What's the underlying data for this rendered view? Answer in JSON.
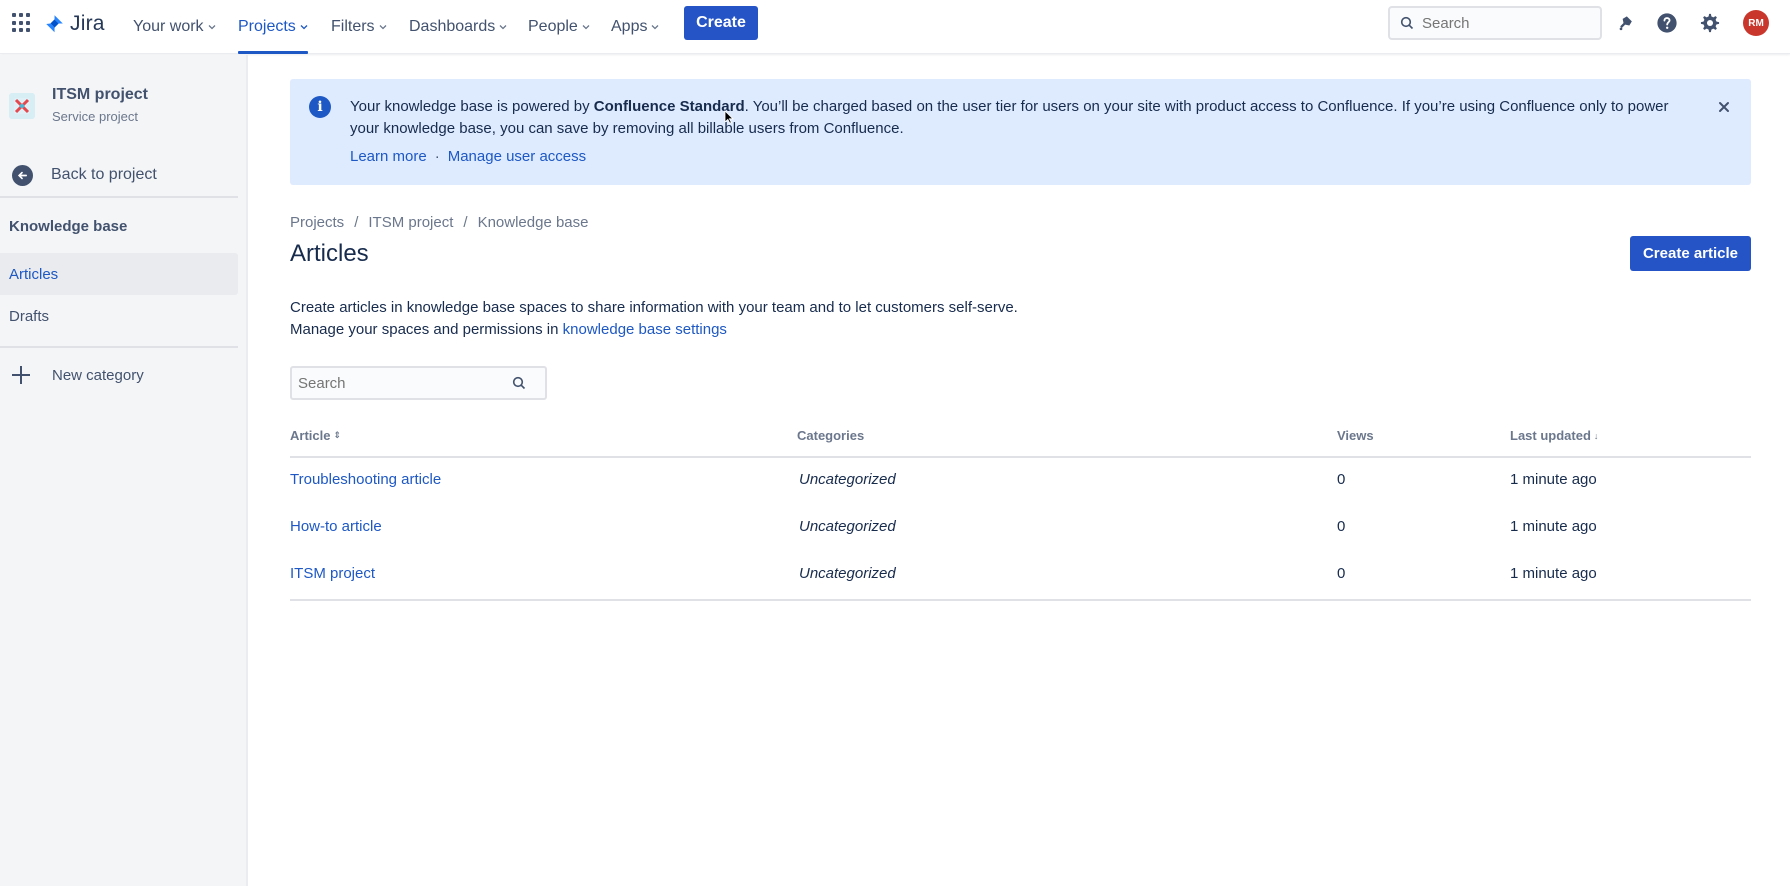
{
  "topnav": {
    "logo_text": "Jira",
    "items": [
      {
        "label": "Your work"
      },
      {
        "label": "Projects"
      },
      {
        "label": "Filters"
      },
      {
        "label": "Dashboards"
      },
      {
        "label": "People"
      },
      {
        "label": "Apps"
      }
    ],
    "active_item": "Projects",
    "create_label": "Create",
    "search_placeholder": "Search",
    "avatar_initials": "RM",
    "colors": {
      "accent": "#1d58c4",
      "button": "#2554c7",
      "avatar": "#c9372c"
    }
  },
  "sidebar": {
    "project_name": "ITSM project",
    "project_type": "Service project",
    "back_label": "Back to project",
    "section_title": "Knowledge base",
    "items": [
      {
        "label": "Articles",
        "active": true
      },
      {
        "label": "Drafts",
        "active": false
      }
    ],
    "new_category_label": "New category"
  },
  "banner": {
    "text_before": "Your knowledge base is powered by ",
    "text_bold": "Confluence Standard",
    "text_after": ". You’ll be charged based on the user tier for users on your site with product access to Confluence. If you’re using Confluence only to power your knowledge base, you can save by removing all billable users from Confluence.",
    "link_learn": "Learn more",
    "link_separator": "·",
    "link_manage": "Manage user access",
    "background": "#deebff"
  },
  "breadcrumb": [
    "Projects",
    "ITSM project",
    "Knowledge base"
  ],
  "breadcrumb_separator": "/",
  "page": {
    "title": "Articles",
    "create_article_label": "Create article",
    "desc_line1": "Create articles in knowledge base spaces to share information with your team and to let customers self-serve.",
    "desc_line2_prefix": "Manage your spaces and permissions in ",
    "desc_link": "knowledge base settings",
    "search_placeholder": "Search"
  },
  "table": {
    "columns": [
      "Article",
      "Categories",
      "Views",
      "Last updated"
    ],
    "rows": [
      {
        "article": "Troubleshooting article",
        "category": "Uncategorized",
        "views": "0",
        "updated": "1 minute ago"
      },
      {
        "article": "How-to article",
        "category": "Uncategorized",
        "views": "0",
        "updated": "1 minute ago"
      },
      {
        "article": "ITSM project",
        "category": "Uncategorized",
        "views": "0",
        "updated": "1 minute ago"
      }
    ]
  }
}
